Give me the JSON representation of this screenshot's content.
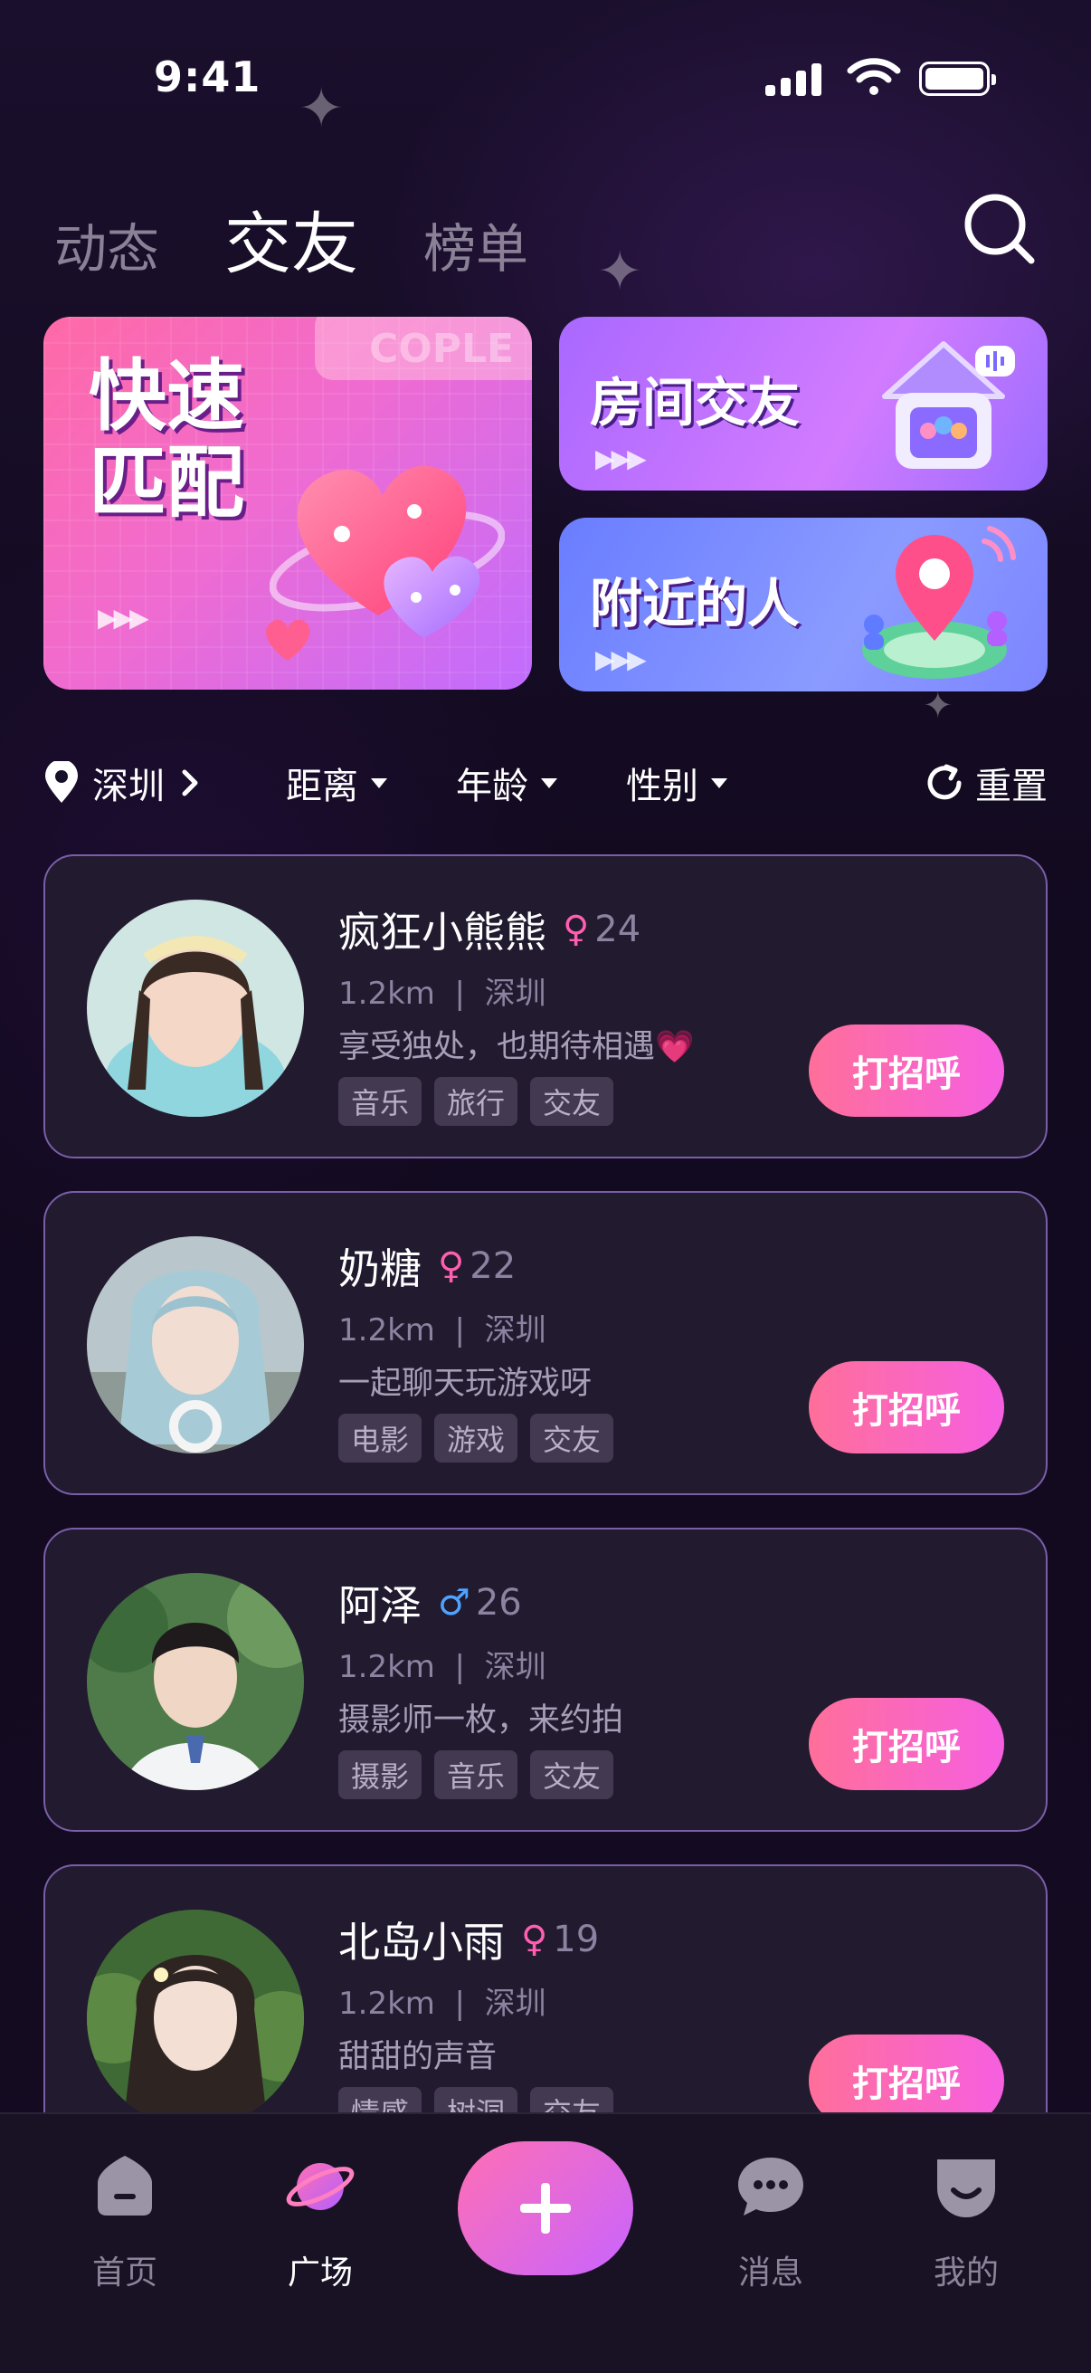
{
  "status_bar": {
    "time": "9:41"
  },
  "top_tabs": [
    {
      "label": "动态",
      "active": false
    },
    {
      "label": "交友",
      "active": true
    },
    {
      "label": "榜单",
      "active": false
    }
  ],
  "banners": {
    "match": {
      "title": "快速\n匹配",
      "watermark": "COPLE"
    },
    "room": {
      "title": "房间交友"
    },
    "nearby": {
      "title": "附近的人"
    }
  },
  "filters": {
    "location": "深圳",
    "distance": "距离",
    "age": "年龄",
    "gender": "性别",
    "reset": "重置"
  },
  "users": [
    {
      "name": "疯狂小熊熊",
      "gender": "female",
      "gender_symbol": "♀",
      "age": "24",
      "distance": "1.2km",
      "city": "深圳",
      "bio": "享受独处，也期待相遇💗",
      "tags": [
        "音乐",
        "旅行",
        "交友"
      ],
      "action": "打招呼"
    },
    {
      "name": "奶糖",
      "gender": "female",
      "gender_symbol": "♀",
      "age": "22",
      "distance": "1.2km",
      "city": "深圳",
      "bio": "一起聊天玩游戏呀",
      "tags": [
        "电影",
        "游戏",
        "交友"
      ],
      "action": "打招呼"
    },
    {
      "name": "阿泽",
      "gender": "male",
      "gender_symbol": "♂",
      "age": "26",
      "distance": "1.2km",
      "city": "深圳",
      "bio": "摄影师一枚，来约拍",
      "tags": [
        "摄影",
        "音乐",
        "交友"
      ],
      "action": "打招呼"
    },
    {
      "name": "北岛小雨",
      "gender": "female",
      "gender_symbol": "♀",
      "age": "19",
      "distance": "1.2km",
      "city": "深圳",
      "bio": "甜甜的声音",
      "tags": [
        "情感",
        "树洞",
        "交友"
      ],
      "action": "打招呼"
    }
  ],
  "bottom_nav": [
    {
      "label": "首页",
      "icon": "home-icon",
      "active": false
    },
    {
      "label": "广场",
      "icon": "planet-icon",
      "active": true
    },
    {
      "label": "",
      "icon": "plus-icon",
      "active": false
    },
    {
      "label": "消息",
      "icon": "chat-bubble-icon",
      "active": false
    },
    {
      "label": "我的",
      "icon": "smile-face-icon",
      "active": false
    }
  ],
  "colors": {
    "background": "#12091f",
    "accent_pink": "#ff6f9a",
    "accent_purple": "#f65fe0",
    "female": "#ff5fb0",
    "male": "#4fa3ff",
    "card_border": "#7a5ea8"
  }
}
